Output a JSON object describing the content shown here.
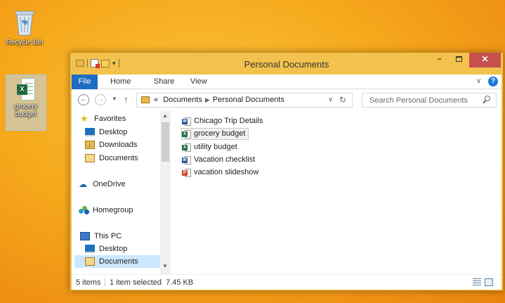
{
  "desktop": {
    "recycle_bin_label": "Recycle Bin",
    "file_icon_label": "grocery budget"
  },
  "window": {
    "title": "Personal Documents"
  },
  "ribbon": {
    "tabs": [
      "File",
      "Home",
      "Share",
      "View"
    ]
  },
  "address": {
    "overflow": "«",
    "crumbs": [
      "Documents",
      "Personal Documents"
    ]
  },
  "search": {
    "placeholder": "Search Personal Documents"
  },
  "navpane": {
    "items": [
      {
        "label": "Favorites",
        "icon": "star-icon"
      },
      {
        "label": "Desktop",
        "icon": "desktop-icon"
      },
      {
        "label": "Downloads",
        "icon": "downloads-icon"
      },
      {
        "label": "Documents",
        "icon": "documents-icon"
      },
      {
        "label": "OneDrive",
        "icon": "onedrive-icon"
      },
      {
        "label": "Homegroup",
        "icon": "homegroup-icon"
      },
      {
        "label": "This PC",
        "icon": "this-pc-icon"
      },
      {
        "label": "Desktop",
        "icon": "desktop-icon"
      },
      {
        "label": "Documents",
        "icon": "documents-icon"
      }
    ]
  },
  "files": [
    {
      "name": "Chicago Trip Details",
      "type": "word"
    },
    {
      "name": "grocery budget",
      "type": "excel",
      "selected": true
    },
    {
      "name": "utility budget",
      "type": "excel"
    },
    {
      "name": "Vacation checklist",
      "type": "word"
    },
    {
      "name": "vacation slideshow",
      "type": "powerpoint"
    }
  ],
  "status": {
    "count": "5 items",
    "selection": "1 item selected  7.45 KB"
  },
  "colors": {
    "accent": "#1e6cc4",
    "close": "#c7504d",
    "selection": "#cce8ff"
  }
}
